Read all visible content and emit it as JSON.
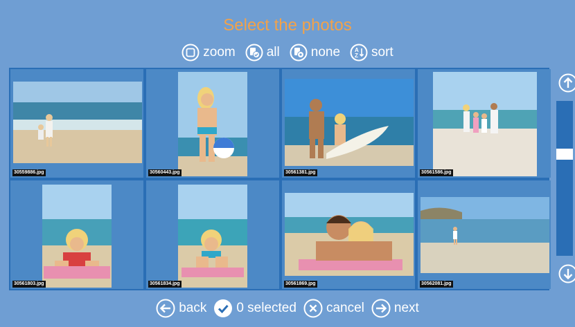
{
  "title": "Select the photos",
  "toolbar": {
    "zoom_label": "zoom",
    "all_label": "all",
    "none_label": "none",
    "sort_label": "sort"
  },
  "photos": [
    {
      "filename": "30559886.jpg",
      "icon": "beach-family-photo"
    },
    {
      "filename": "30560443.jpg",
      "icon": "woman-beachball-photo"
    },
    {
      "filename": "30561381.jpg",
      "icon": "couple-surfboard-photo"
    },
    {
      "filename": "30561586.jpg",
      "icon": "family-beach-photo"
    },
    {
      "filename": "30561803.jpg",
      "icon": "woman-lying-towel-photo"
    },
    {
      "filename": "30561834.jpg",
      "icon": "woman-lying-sand-photo"
    },
    {
      "filename": "30561869.jpg",
      "icon": "couple-lying-photo"
    },
    {
      "filename": "30562081.jpg",
      "icon": "man-shore-photo"
    }
  ],
  "scroll": {
    "up_icon": "arrow-up-icon",
    "down_icon": "arrow-down-icon",
    "position": 0.33
  },
  "bottom": {
    "back_label": "back",
    "selected_label": "0 selected",
    "cancel_label": "cancel",
    "next_label": "next"
  },
  "colors": {
    "background": "#6f9ed3",
    "grid": "#2a6eb5",
    "title": "#f2a24a",
    "accent": "#ffffff"
  }
}
